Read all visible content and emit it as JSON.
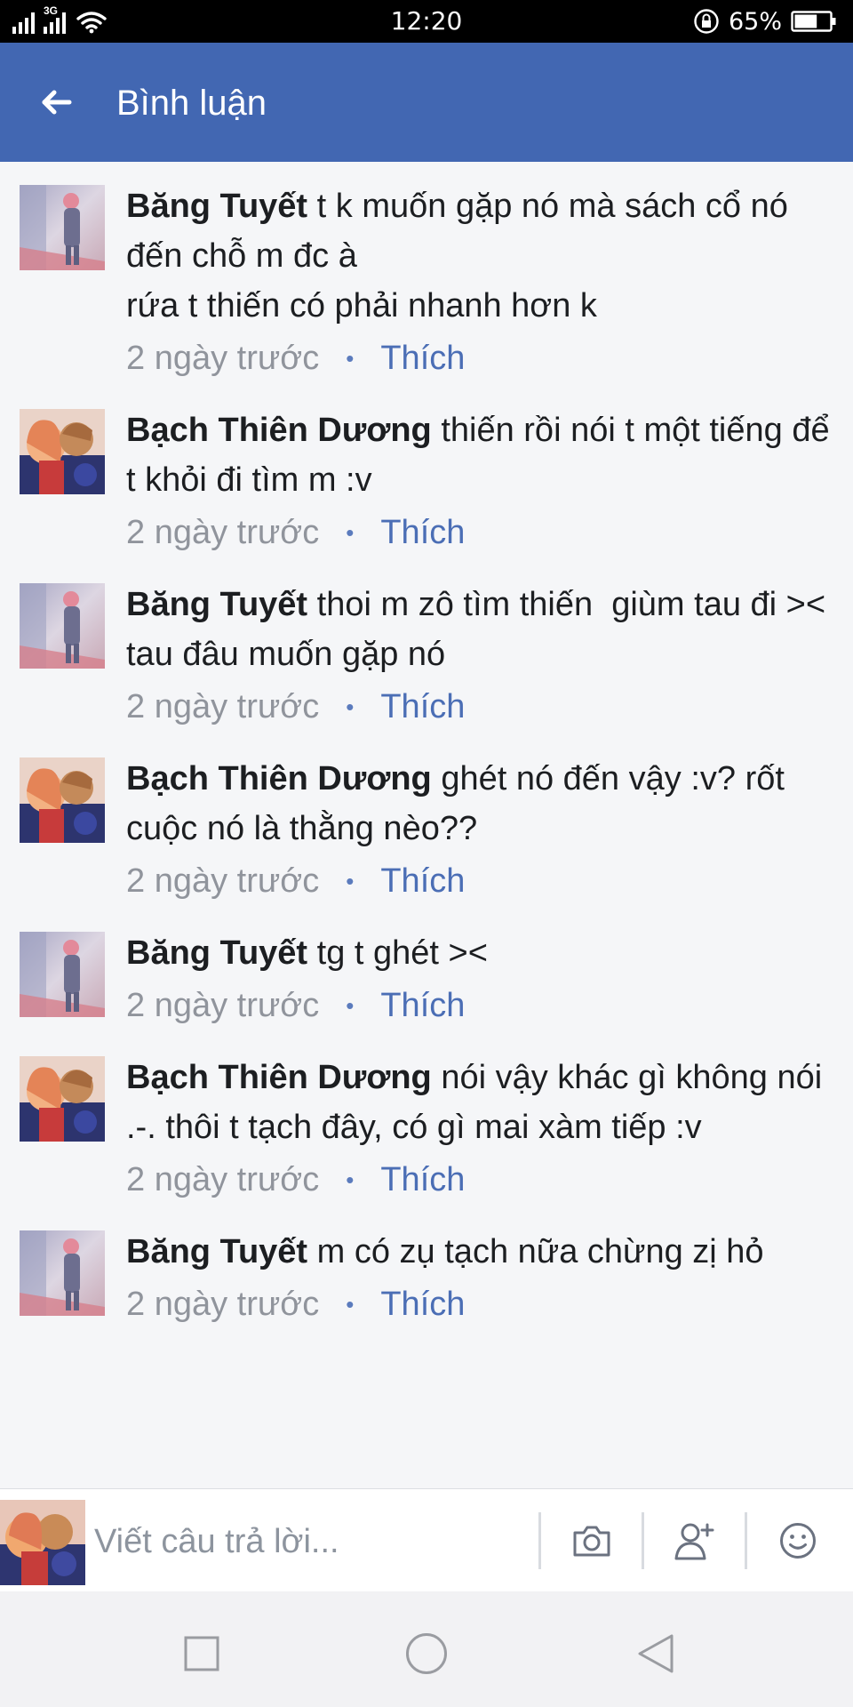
{
  "status_bar": {
    "network_label": "3G",
    "time": "12:20",
    "battery_percent": "65%",
    "battery_level": 0.65,
    "icons": [
      "signal-icon",
      "wifi-icon",
      "rotation-lock-icon",
      "battery-icon"
    ]
  },
  "header": {
    "back_icon": "arrow-left-icon",
    "title": "Bình luận",
    "background": "#4267b2"
  },
  "comments": [
    {
      "author": "Băng Tuyết",
      "text": " t k muốn gặp nó mà sách cổ nó đến chỗ m đc à\nrứa t thiến có phải nhanh hơn k",
      "time": "2 ngày trước",
      "like_label": "Thích",
      "avatar": "bang-tuyet"
    },
    {
      "author": "Bạch Thiên Dương",
      "text": " thiến rồi nói t một tiếng để t khỏi đi tìm m :v",
      "time": "2 ngày trước",
      "like_label": "Thích",
      "avatar": "bach-thien-duong"
    },
    {
      "author": "Băng Tuyết",
      "text": " thoi m zô tìm thiến  giùm tau đi >< tau đâu muốn gặp nó",
      "time": "2 ngày trước",
      "like_label": "Thích",
      "avatar": "bang-tuyet"
    },
    {
      "author": "Bạch Thiên Dương",
      "text": " ghét nó đến vậy :v? rốt cuộc nó là thằng nèo??",
      "time": "2 ngày trước",
      "like_label": "Thích",
      "avatar": "bach-thien-duong"
    },
    {
      "author": "Băng Tuyết",
      "text": " tg t ghét ><",
      "time": "2 ngày trước",
      "like_label": "Thích",
      "avatar": "bang-tuyet"
    },
    {
      "author": "Bạch Thiên Dương",
      "text": " nói vậy khác gì không nói .-. thôi t tạch đây, có gì mai xàm tiếp :v",
      "time": "2 ngày trước",
      "like_label": "Thích",
      "avatar": "bach-thien-duong"
    },
    {
      "author": "Băng Tuyết",
      "text": " m có zụ tạch nữa chừng zị hỏ",
      "time": "2 ngày trước",
      "like_label": "Thích",
      "avatar": "bang-tuyet"
    }
  ],
  "composer": {
    "placeholder": "Viết câu trả lời...",
    "buttons": [
      "camera-icon",
      "tag-friend-icon",
      "emoji-icon"
    ]
  },
  "nav_bar": {
    "buttons": [
      "recent-apps-icon",
      "home-icon",
      "back-triangle-icon"
    ]
  },
  "colors": {
    "accent": "#4267b2",
    "link": "#4b6eb5",
    "meta_text": "#90949c",
    "background": "#f5f6f8"
  }
}
